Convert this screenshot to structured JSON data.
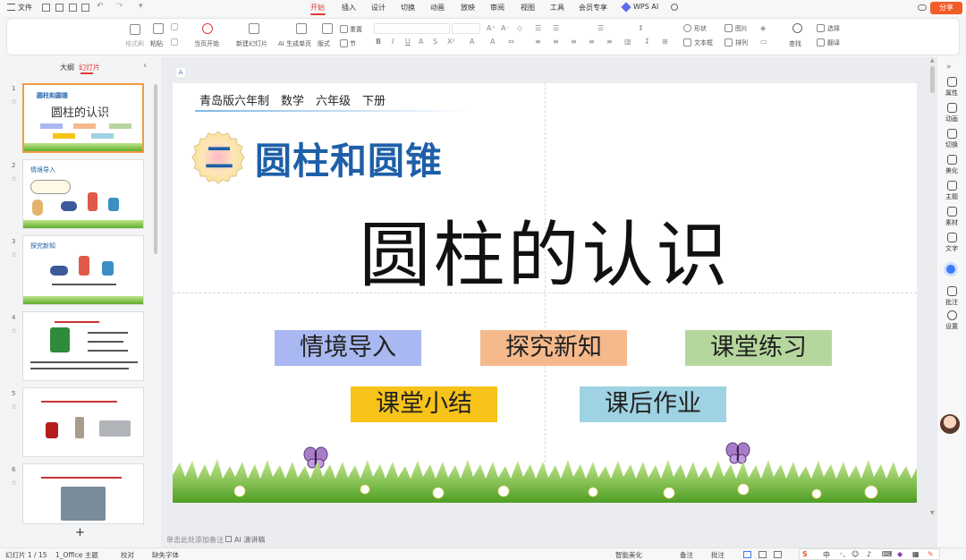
{
  "titlebar": {
    "file_menu": "文件",
    "tabs": [
      "开始",
      "插入",
      "设计",
      "切换",
      "动画",
      "放映",
      "审阅",
      "视图",
      "工具",
      "会员专享"
    ],
    "wps_ai": "WPS AI",
    "share": "分享"
  },
  "ribbon": {
    "format_painter": "格式刷",
    "paste": "粘贴",
    "play_from_current": "当页开始",
    "new_slide": "新建幻灯片",
    "ai_generate": "AI 生成单页",
    "layout": "版式",
    "section": "节",
    "reset": "重置",
    "shape": "形状",
    "picture": "图片",
    "textbox": "文本框",
    "arrange": "排列",
    "find": "查找",
    "select": "选择",
    "translate": "翻译"
  },
  "panel": {
    "tab_outline": "大纲",
    "tab_slides": "幻灯片",
    "add": "+"
  },
  "thumbnails": [
    {
      "num": "1",
      "title": "圆柱的认识",
      "sub": "圆柱和圆锥"
    },
    {
      "num": "2",
      "title": "情境导入"
    },
    {
      "num": "3",
      "title": "探究新知"
    },
    {
      "num": "4",
      "title": ""
    },
    {
      "num": "5",
      "title": ""
    },
    {
      "num": "6",
      "title": ""
    }
  ],
  "slide": {
    "header": "青岛版六年制　数学　六年级　下册",
    "chapter_num": "二",
    "chapter_title": "圆柱和圆锥",
    "main_title": "圆柱的认识",
    "tags": [
      {
        "label": "情境导入",
        "color": "#a9b8f0"
      },
      {
        "label": "探究新知",
        "color": "#f5b98c"
      },
      {
        "label": "课堂练习",
        "color": "#b5d79e"
      },
      {
        "label": "课堂小结",
        "color": "#f7c318"
      },
      {
        "label": "课后作业",
        "color": "#9fd2e2"
      }
    ]
  },
  "notes": {
    "placeholder": "单击此处添加备注",
    "ai_speech": "AI 演讲稿"
  },
  "rightbar": [
    "属性",
    "动画",
    "切换",
    "美化",
    "主题",
    "素材",
    "文字",
    "批注",
    "设置"
  ],
  "status": {
    "slide_count": "幻灯片 1 / 15",
    "theme": "1_Office 主题",
    "proof": "校对",
    "missing_font": "缺失字体",
    "beautify": "智能美化",
    "notes": "备注",
    "comment": "批注",
    "ime": "中"
  }
}
